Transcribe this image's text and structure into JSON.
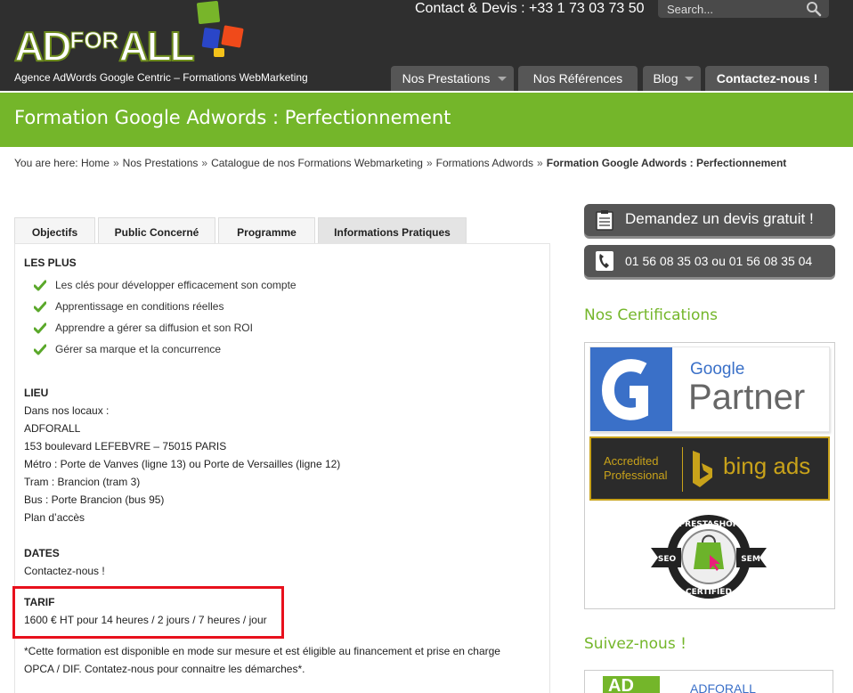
{
  "header": {
    "logo": {
      "ad": "AD",
      "for": "FOR",
      "all": "ALL"
    },
    "tagline": "Agence AdWords Google Centric – Formations WebMarketing",
    "contact": "Contact & Devis : +33 1 73 03 73 50",
    "search_placeholder": "Search...",
    "search_icon": "magnifier-icon"
  },
  "nav": [
    {
      "label": "Nos Prestations",
      "dropdown": true
    },
    {
      "label": "Nos Références",
      "dropdown": false
    },
    {
      "label": "Blog",
      "dropdown": true
    },
    {
      "label": "Contactez-nous !",
      "dropdown": false
    }
  ],
  "page_title": "Formation Google Adwords : Perfectionnement",
  "breadcrumb": {
    "prefix": "You are here:",
    "items": [
      "Home",
      "Nos Prestations",
      "Catalogue de nos Formations Webmarketing",
      "Formations Adwords"
    ],
    "current": "Formation Google Adwords : Perfectionnement",
    "separator": "»"
  },
  "tabs": [
    {
      "label": "Objectifs"
    },
    {
      "label": "Public Concerné"
    },
    {
      "label": "Programme"
    },
    {
      "label": "Informations Pratiques",
      "active": true
    }
  ],
  "les_plus": {
    "heading": "LES PLUS",
    "items": [
      "Les clés pour développer efficacement son compte",
      "Apprentissage en conditions réelles",
      "Apprendre a gérer sa diffusion et son ROI",
      "Gérer sa marque et la concurrence"
    ]
  },
  "lieu": {
    "heading": "LIEU",
    "lines": [
      "Dans nos locaux :",
      "ADFORALL",
      "153 boulevard LEFEBVRE – 75015 PARIS",
      "Métro : Porte de Vanves (ligne 13) ou Porte de Versailles (ligne 12)",
      "Tram : Brancion (tram 3)",
      "Bus : Porte Brancion (bus 95)",
      "Plan d’accès"
    ]
  },
  "dates": {
    "heading": "DATES",
    "text": "Contactez-nous !"
  },
  "tarif": {
    "heading": "TARIF",
    "text": "1600 € HT pour 14 heures / 2 jours / 7 heures / jour"
  },
  "note": {
    "line1": "*Cette formation est disponible en mode sur mesure et est éligible au financement et prise en charge",
    "line2": "OPCA / DIF. Contatez-nous pour connaitre les démarches*."
  },
  "sidebar": {
    "devis_label": "Demandez un devis gratuit !",
    "phone_label": "01 56 08 35 03 ou 01 56 08 35 04",
    "certifications_heading": "Nos Certifications",
    "google_badge": {
      "brand": "Google",
      "word": "Partner"
    },
    "bing_badge": {
      "line1": "Accredited",
      "line2": "Professional",
      "brand": "bing ads"
    },
    "presta_badge": {
      "top": "PRESTASHOP",
      "left": "SEO",
      "right": "SEM",
      "bottom": "CERTIFIED"
    },
    "follow_heading": "Suivez-nous !",
    "follow_logo": "AD",
    "follow_name": "ADFORALL"
  },
  "colors": {
    "header_bg": "#2f2f2f",
    "accent_green": "#74b62a",
    "nav_bg": "#565656",
    "highlight_red": "#e8101c",
    "cta_bg": "#555555"
  }
}
